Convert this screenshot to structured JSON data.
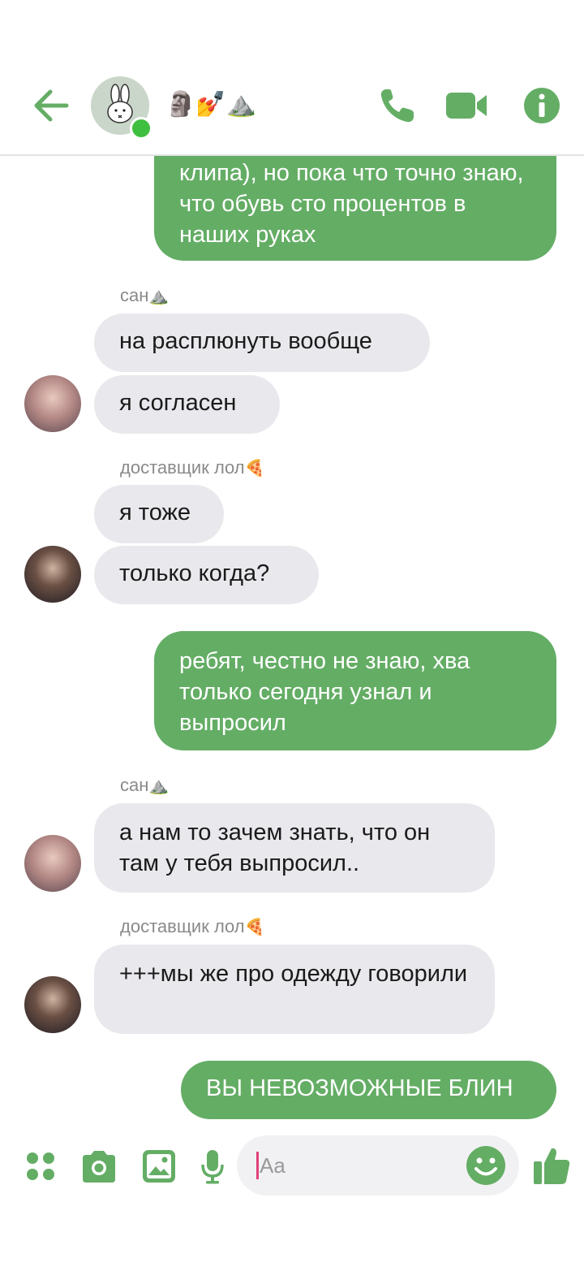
{
  "header": {
    "title_emojis": "🗿💅⛰️",
    "accent_color": "#64ad65"
  },
  "icons": {
    "back": "arrow-left-icon",
    "phone": "phone-icon",
    "video": "video-camera-icon",
    "info": "info-icon",
    "apps": "four-dots-icon",
    "camera": "camera-icon",
    "gallery": "image-icon",
    "mic": "microphone-icon",
    "emoji": "smiley-icon",
    "like": "thumbs-up-icon"
  },
  "messages": [
    {
      "type": "out",
      "text": "клипа), но пока что точно знаю, что обувь сто процентов в наших руках"
    },
    {
      "type": "sender",
      "name": "сан",
      "emoji": "⛰️"
    },
    {
      "type": "in",
      "text": "на расплюнуть вообще"
    },
    {
      "type": "in",
      "text": "я согласен"
    },
    {
      "type": "sender",
      "name": "доставщик лол",
      "emoji": "🍕"
    },
    {
      "type": "in",
      "text": "я тоже"
    },
    {
      "type": "in",
      "text": "только когда?"
    },
    {
      "type": "out",
      "text": "ребят, честно не знаю, хва только сегодня узнал и выпросил"
    },
    {
      "type": "sender",
      "name": "сан",
      "emoji": "⛰️"
    },
    {
      "type": "in",
      "text": "а нам то зачем знать, что он там у тебя выпросил.."
    },
    {
      "type": "sender",
      "name": "доставщик лол",
      "emoji": "🍕"
    },
    {
      "type": "in",
      "text": "+++мы же про одежду говорили"
    },
    {
      "type": "out",
      "text": "ВЫ НЕВОЗМОЖНЫЕ БЛИН"
    }
  ],
  "composer": {
    "placeholder": "Aa"
  }
}
